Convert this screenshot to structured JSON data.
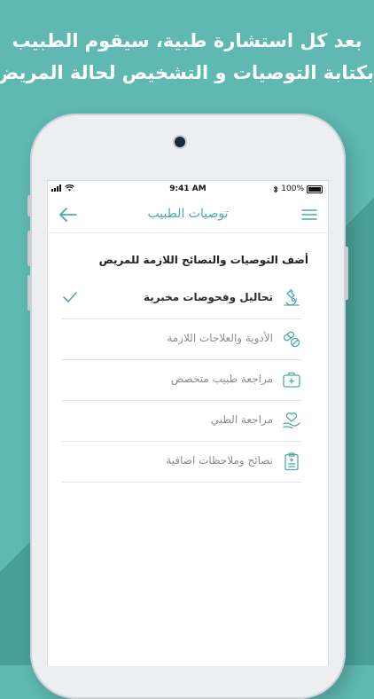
{
  "headline": {
    "line1": "بعد كل استشارة طبية، سيقوم الطبيب",
    "line2": "بكتابة التوصيات و التشخيص لحالة المريض"
  },
  "status_bar": {
    "time": "9:41 AM",
    "battery": "100%"
  },
  "nav": {
    "title": "توصيات الطبيب"
  },
  "section_heading": "أضف التوصيات والنصائح اللازمة للمريض",
  "items": [
    {
      "label": "تحاليل وفحوصات مخبرية",
      "icon": "microscope-icon",
      "selected": true
    },
    {
      "label": "الأدوية والعلاجات اللازمة",
      "icon": "pills-icon",
      "selected": false
    },
    {
      "label": "مراجعة طبيب متخصص",
      "icon": "medical-kit-icon",
      "selected": false
    },
    {
      "label": "مراجعة الطبي",
      "icon": "heart-hand-icon",
      "selected": false
    },
    {
      "label": "نصائح وملاحظات اضافية",
      "icon": "clipboard-icon",
      "selected": false
    }
  ],
  "colors": {
    "accent": "#4eaaa6",
    "background": "#5fb8b2"
  }
}
